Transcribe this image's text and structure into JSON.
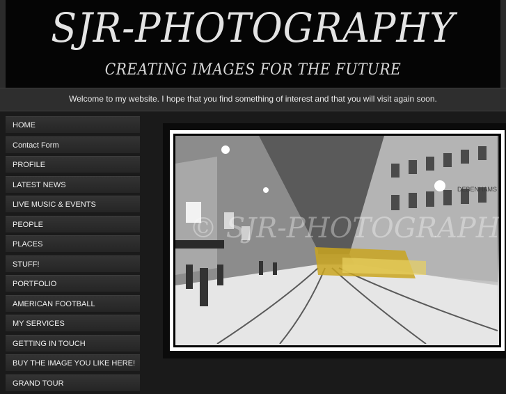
{
  "header": {
    "title": "SJR-PHOTOGRAPHY",
    "tagline": "CREATING IMAGES FOR THE FUTURE"
  },
  "welcome": "Welcome to my website. I hope that you find something of interest and that you will visit again soon.",
  "nav": {
    "items": [
      {
        "label": "HOME"
      },
      {
        "label": "Contact Form"
      },
      {
        "label": "PROFILE"
      },
      {
        "label": "LATEST NEWS"
      },
      {
        "label": "LIVE MUSIC & EVENTS"
      },
      {
        "label": "PEOPLE"
      },
      {
        "label": "PLACES"
      },
      {
        "label": "STUFF!"
      },
      {
        "label": "PORTFOLIO"
      },
      {
        "label": "AMERICAN FOOTBALL"
      },
      {
        "label": "MY SERVICES"
      },
      {
        "label": "GETTING IN TOUCH"
      },
      {
        "label": "BUY THE IMAGE YOU LIKE HERE!"
      },
      {
        "label": "GRAND TOUR"
      }
    ]
  },
  "photo": {
    "watermark": "© SJR-PHOTOGRAPHY",
    "store_sign": "DEBENHAMS"
  }
}
